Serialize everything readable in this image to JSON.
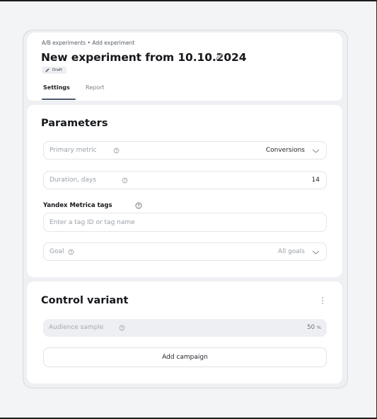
{
  "header": {
    "breadcrumb": "A/B experiments • Add experiment",
    "title": "New experiment from 10.10.2024",
    "badge": "Draft",
    "tabs": [
      {
        "label": "Settings",
        "active": true
      },
      {
        "label": "Report",
        "active": false
      }
    ]
  },
  "parameters": {
    "title": "Parameters",
    "primary_metric": {
      "label": "Primary metric",
      "value": "Conversions"
    },
    "duration": {
      "label": "Duration, days",
      "value": "14"
    },
    "metrica_tags": {
      "label": "Yandex Metrica tags",
      "placeholder": "Enter a tag ID or tag name"
    },
    "goal": {
      "label": "Goal",
      "value": "All goals"
    }
  },
  "control_variant": {
    "title": "Control variant",
    "audience": {
      "label": "Audience sample",
      "value": "50",
      "unit": "%"
    },
    "add_campaign_label": "Add campaign"
  },
  "icons": [
    "pencil-icon",
    "help-circle-icon",
    "chevron-down-icon",
    "kebab-menu-icon"
  ],
  "colors": {
    "accent": "#4d5a6b",
    "page_bg": "#f3f4f6",
    "card_bg": "#ffffff",
    "muted_text": "#9aa0a7"
  }
}
